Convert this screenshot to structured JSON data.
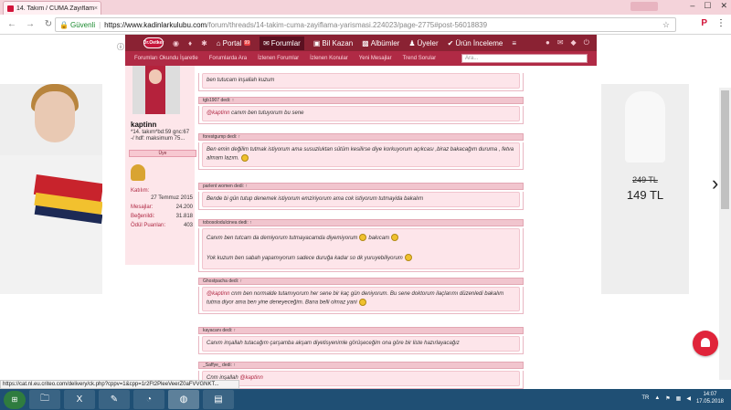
{
  "browser": {
    "tab_title": "14. Takım / CUMA Zayıflam",
    "tab_close": "×",
    "secure_label": "Güvenli",
    "url_host": "https://www.kadinlarkulubu.com",
    "url_path": "/forum/threads/14-takim-cuma-zayiflama-yarismasi.224023/page-2775#post-56018839",
    "status_url": "https://cat.nl.eu.criteo.com/delivery/ck.php?cppv=1&cpp=1r2Ft2PleeVeerZ0aFVVGNKT..."
  },
  "forum": {
    "nav": {
      "portal": "Portal",
      "portal_badge": "99",
      "forumlar": "Forumlar",
      "bil_kazan": "Bil Kazan",
      "albumler": "Albümler",
      "uyeler": "Üyeler",
      "urun_inceleme": "Ürün İnceleme"
    },
    "subnav": [
      "Forumları Okundu İşaretle",
      "Forumlarda Ara",
      "İzlenen Forumlar",
      "İzlenen Konular",
      "Yeni Mesajlar",
      "Trend Sorular"
    ],
    "search_placeholder": "Ara...",
    "user": {
      "name": "kaptinn",
      "status": "*14. takım*bd:59 gnc:67 -/ hdf: maksimum 75...",
      "role": "Üye",
      "joined_label": "Katılım:",
      "joined": "27 Temmuz 2015",
      "messages_label": "Mesajlar:",
      "messages": "24.200",
      "likes_label": "Beğenildi:",
      "likes": "31.818",
      "points_label": "Ödül Puanları:",
      "points": "403"
    },
    "posts": [
      {
        "head": "",
        "body": [
          "ben tutucam inşallah kuzum"
        ]
      },
      {
        "head": "tgb1907 dedi: ↑",
        "mention": "@kaptinn",
        "body": [
          "canım ben tutuyorum bu sene"
        ]
      },
      {
        "head": "forestgump dedi: ↑",
        "body": [
          "Ben emin değilim tutmak istiyorum ama susuzluktan sütüm kesilirse diye korkuyorum açıkcası ,biraz bakacağım duruma , fetva almam lazım."
        ]
      },
      {
        "head": "parlent women dedi: ↑",
        "body": [
          "Bende bi gün tutup denemek istiyorum emziriyorum ama cok istiyorum tutmayida bakalım"
        ]
      },
      {
        "head": "tobosolodulcinea dedi: ↑",
        "body": [
          "Canım ben tutcam da demiyorum tutmayacamda diyemiyorum",
          "bakıcam",
          "Yok kuzum ben sabah yapamıyorum sadece duruğa kadar so dk yuruyebiliyorum"
        ]
      },
      {
        "head": "Ghostpacha dedi: ↑",
        "mention": "@kaptinn",
        "body": [
          "cnm ben normalde tutamıyorum her sene bir kaç gün deniyorum. Bu sene doktorum ilaçlarımı düzenledi bakalım tutma diyor ama ben yine deneyeceğim. Bana belli olmaz yani"
        ]
      },
      {
        "head": "kayacanı dedi: ↑",
        "body": [
          "Canım inşallah tutacağım çarşamba akşam diyetisyenimle görüşeceğim ona göre bir liste hazırlayacağız"
        ]
      },
      {
        "head": "_Saffye_ dedi: ↑",
        "mention": "@kaptinn",
        "body": [
          "Cnm inşallah"
        ]
      }
    ]
  },
  "ads": {
    "old_price": "249 TL",
    "new_price": "149 TL"
  },
  "taskbar": {
    "lang": "TR",
    "time": "14:07",
    "date": "17.05.2018"
  },
  "colors": {
    "brand": "#b02a45",
    "forum_bar": "#8a2233",
    "post_bg": "#fde5ea",
    "taskbar": "#1f4f74"
  }
}
